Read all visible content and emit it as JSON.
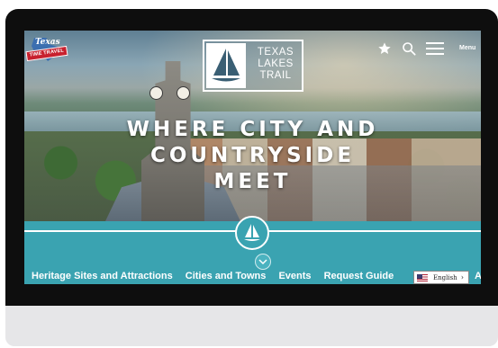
{
  "header": {
    "logo_script": "Texas",
    "logo_ribbon": "TIME TRAVEL",
    "brand_lines": [
      "TEXAS",
      "LAKES",
      "TRAIL"
    ],
    "favorites_icon": "star-icon",
    "search_icon": "search-icon",
    "menu_icon": "hamburger-icon",
    "menu_label": "Menu"
  },
  "hero": {
    "headline_line1": "WHERE CITY AND COUNTRYSIDE",
    "headline_line2": "MEET"
  },
  "nav": {
    "items": [
      "Heritage Sites and Attractions",
      "Cities and Towns",
      "Events",
      "Request Guide"
    ],
    "overflow": "A"
  },
  "language": {
    "selected": "English",
    "chevron": "›"
  },
  "colors": {
    "teal": "#3aa3b1",
    "device": "#0e0e0e",
    "ribbon_red": "#c8202e",
    "badge_blue": "#3c6fb0"
  }
}
